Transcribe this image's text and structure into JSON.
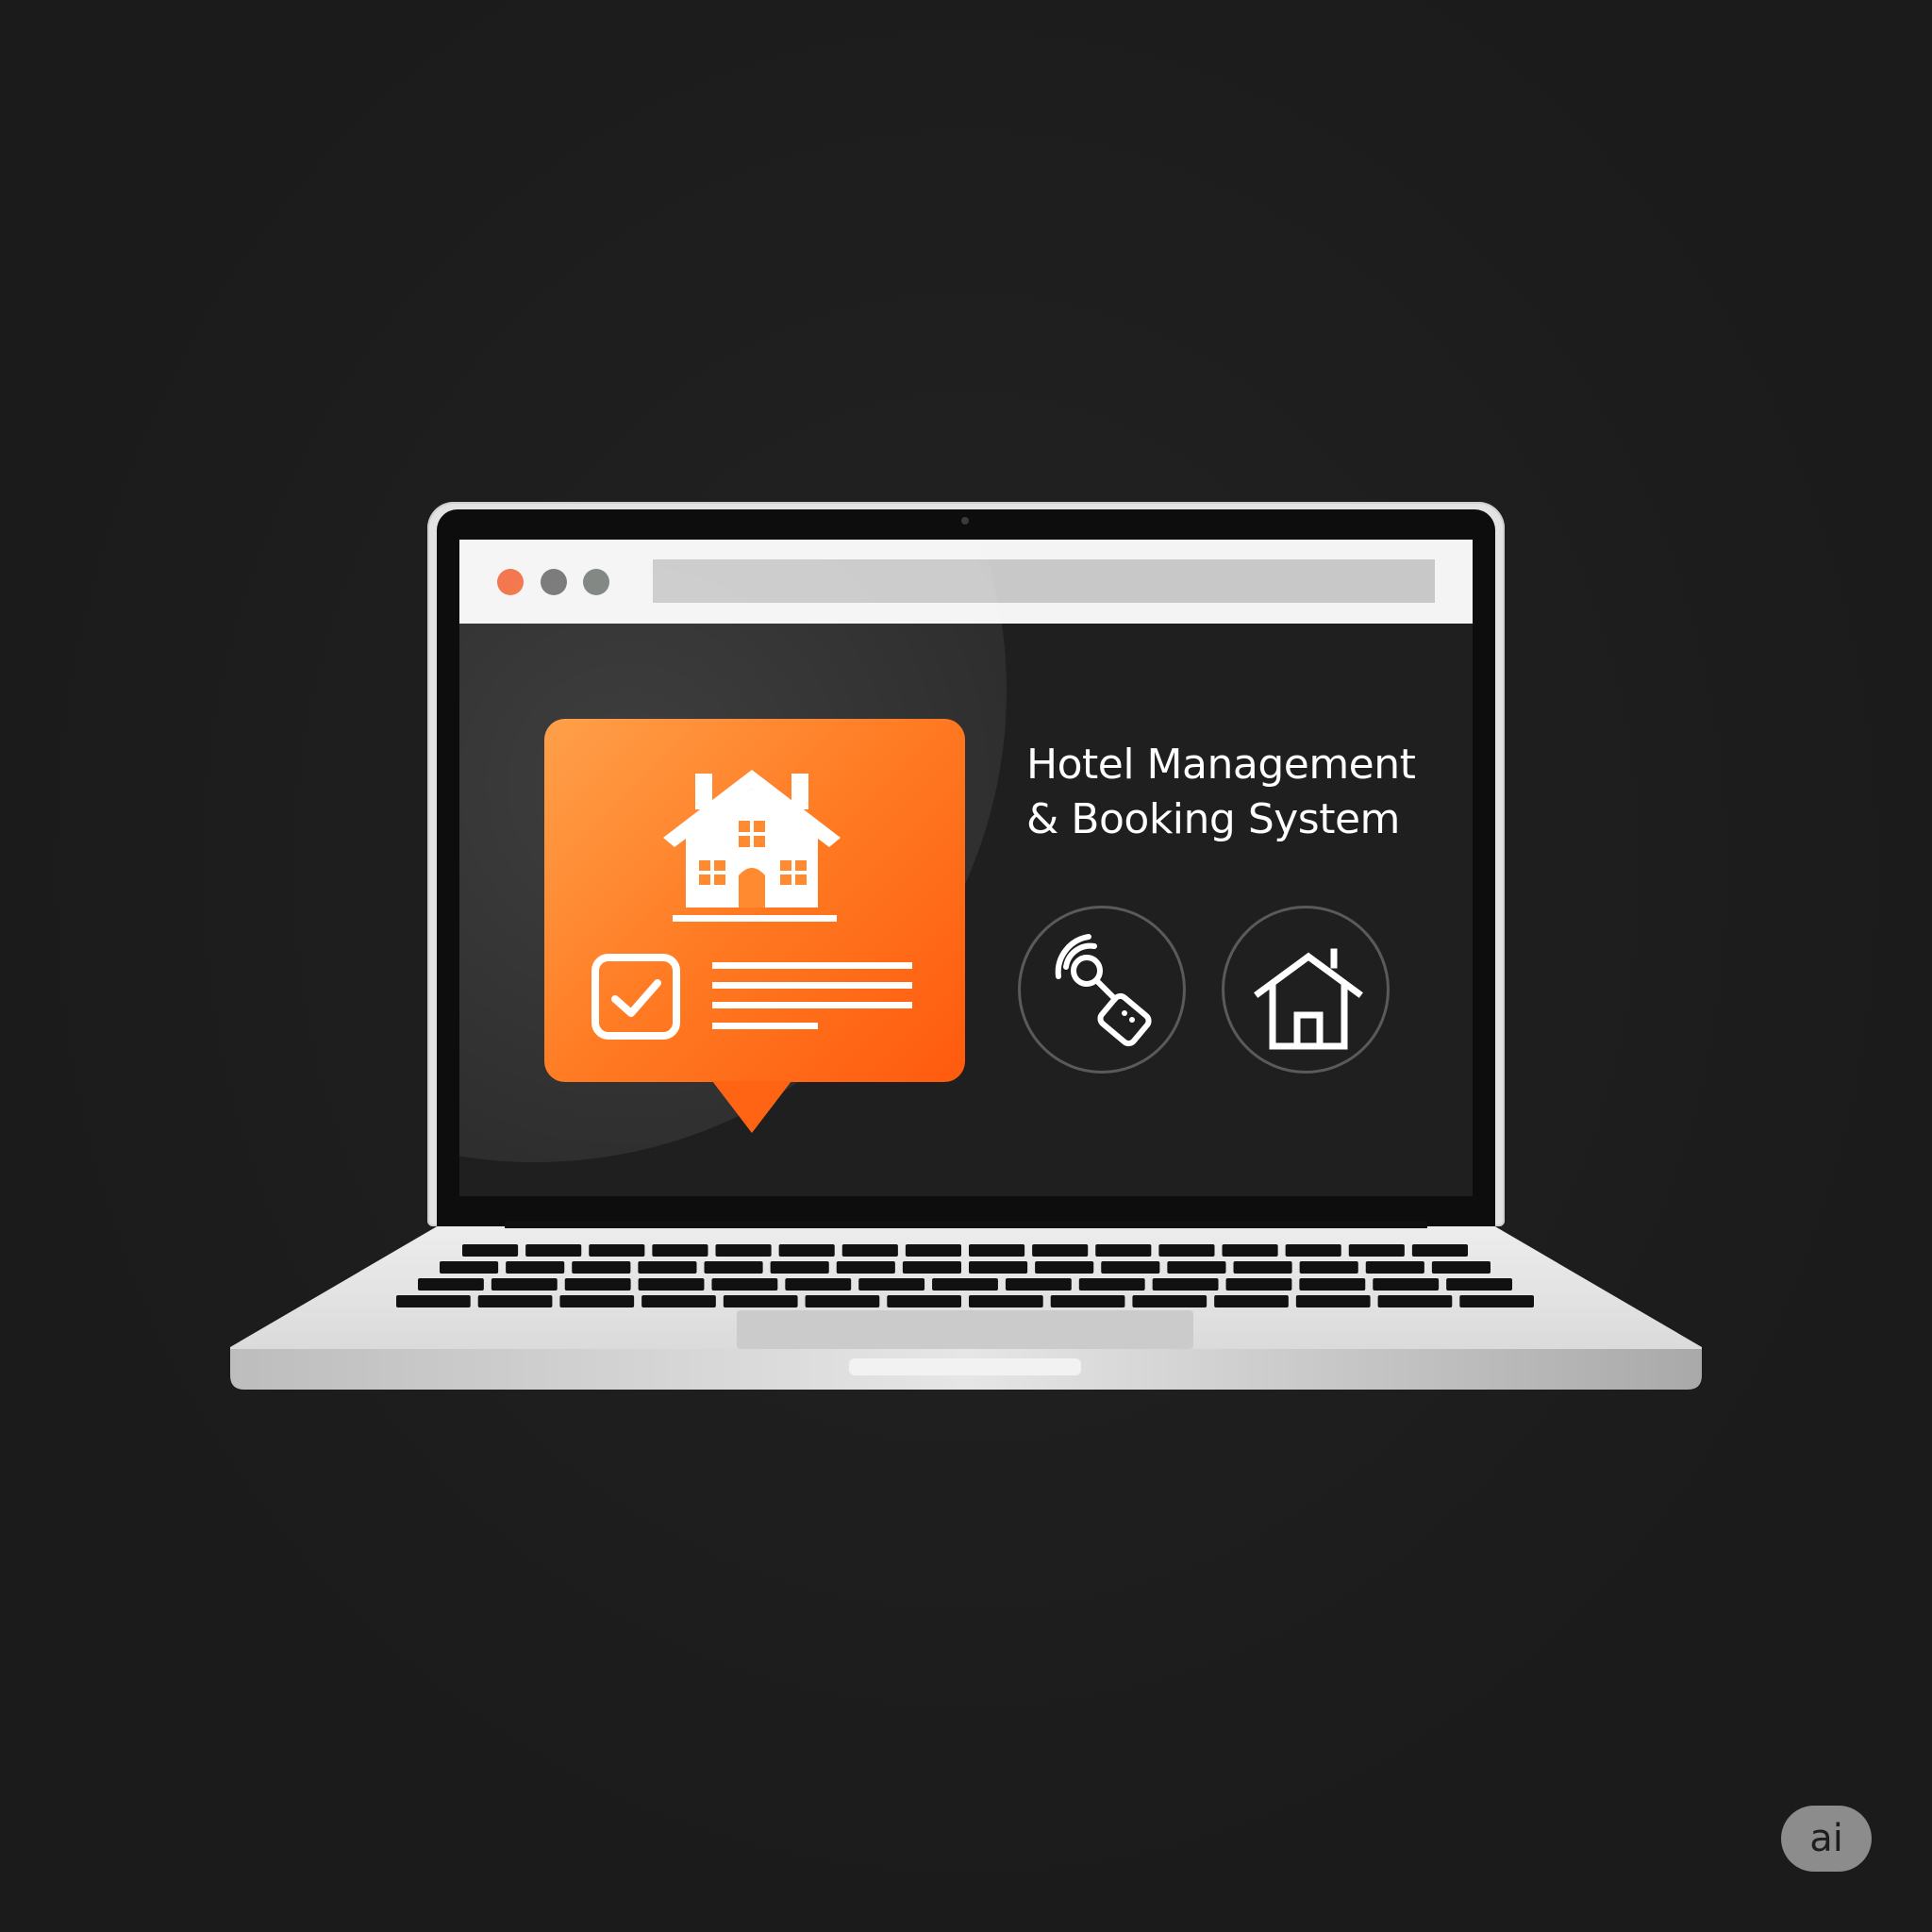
{
  "app": {
    "headline_line1": "Hotel Management",
    "headline_line2": "& Booking System"
  },
  "browser": {
    "window_controls": [
      "close-dot",
      "minimize-dot",
      "maximize-dot"
    ],
    "address": ""
  },
  "feature_card": {
    "icons": [
      "hotel-building-icon",
      "checkbox-checked-icon",
      "text-lines-icon"
    ]
  },
  "actions": [
    {
      "icon": "key-card-icon"
    },
    {
      "icon": "home-icon"
    }
  ],
  "watermark": {
    "label": "ai"
  },
  "colors": {
    "accent": "#ff7a22",
    "accent_light": "#ffa04a",
    "accent_dark": "#ff5a0e",
    "screen_bg": "#1f1f1f",
    "page_bg": "#1c1c1c",
    "close_dot": "#f26a3c"
  }
}
